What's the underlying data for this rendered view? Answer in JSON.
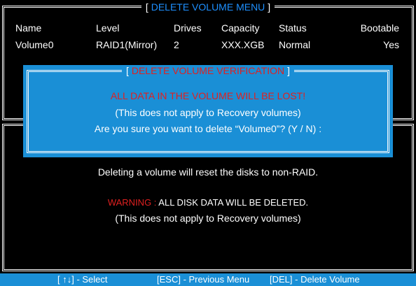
{
  "menu": {
    "title_open": "[",
    "title": "DELETE VOLUME MENU",
    "title_close": "]"
  },
  "table": {
    "headers": [
      "Name",
      "Level",
      "Drives",
      "Capacity",
      "Status",
      "Bootable"
    ],
    "row": [
      "Volume0",
      "RAID1(Mirror)",
      "2",
      "XXX.XGB",
      "Normal",
      "Yes"
    ]
  },
  "dialog": {
    "title_open": "[",
    "title": "DELETE VOLUME VERIFICATION",
    "title_close": "]",
    "warning": "ALL DATA IN THE VOLUME WILL BE LOST!",
    "note": "(This does not apply to Recovery volumes)",
    "prompt": "Are you sure you want to delete “Volume0”? (Y / N) :"
  },
  "info": {
    "line1": "Deleting a volume will reset the disks to non-RAID.",
    "warning_label": "WARNING :",
    "warning_text": " ALL DISK DATA WILL BE DELETED.",
    "line3": "(This does not apply to Recovery volumes)"
  },
  "footer": {
    "select": "[ ↑↓] - Select",
    "previous": "[ESC] - Previous Menu",
    "delete": "[DEL] - Delete  Volume"
  },
  "colors": {
    "accent_blue": "#1a8fd6",
    "title_blue": "#1e90ff",
    "warning_red": "#e02020"
  }
}
